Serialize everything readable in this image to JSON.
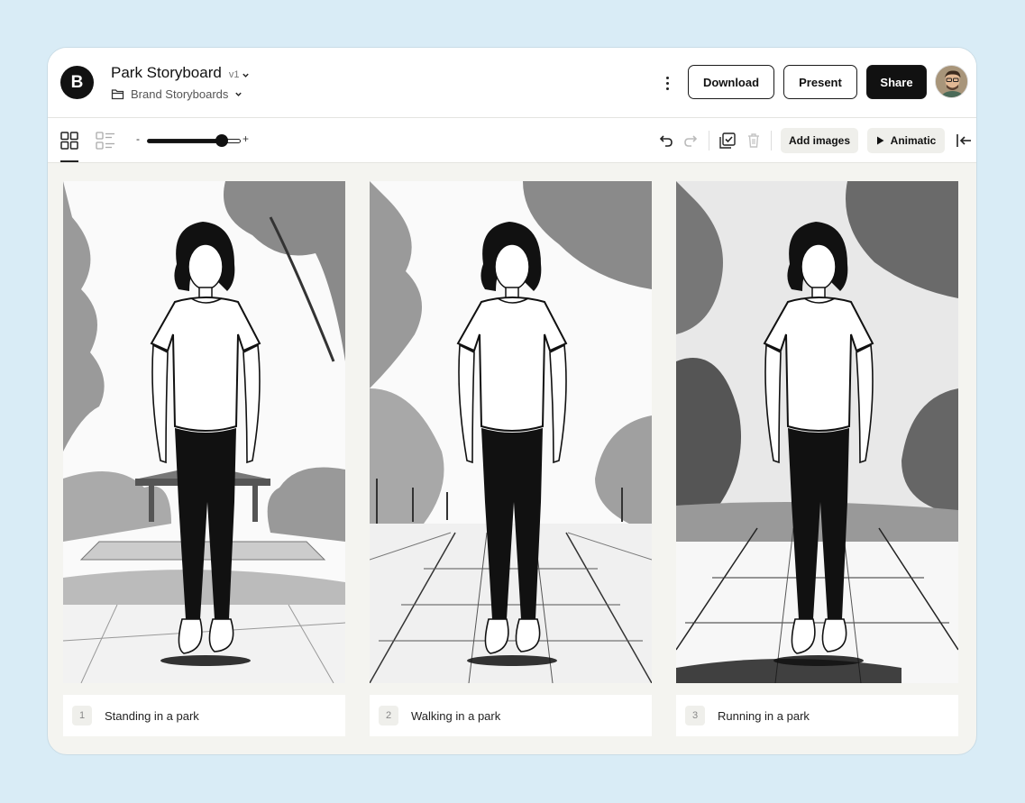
{
  "app": {
    "logo_letter": "B"
  },
  "header": {
    "title": "Park Storyboard",
    "version": "v1",
    "folder": "Brand Storyboards",
    "download_label": "Download",
    "present_label": "Present",
    "share_label": "Share"
  },
  "toolbar": {
    "zoom_minus": "-",
    "zoom_plus": "+",
    "zoom_level": 0.8,
    "add_images_label": "Add images",
    "animatic_label": "Animatic"
  },
  "frames": [
    {
      "number": "1",
      "caption": "Standing in a park"
    },
    {
      "number": "2",
      "caption": "Walking in a park"
    },
    {
      "number": "3",
      "caption": "Running in a park"
    }
  ],
  "colors": {
    "accent": "#111111",
    "background": "#d9ecf6",
    "canvas": "#f4f4f0"
  }
}
